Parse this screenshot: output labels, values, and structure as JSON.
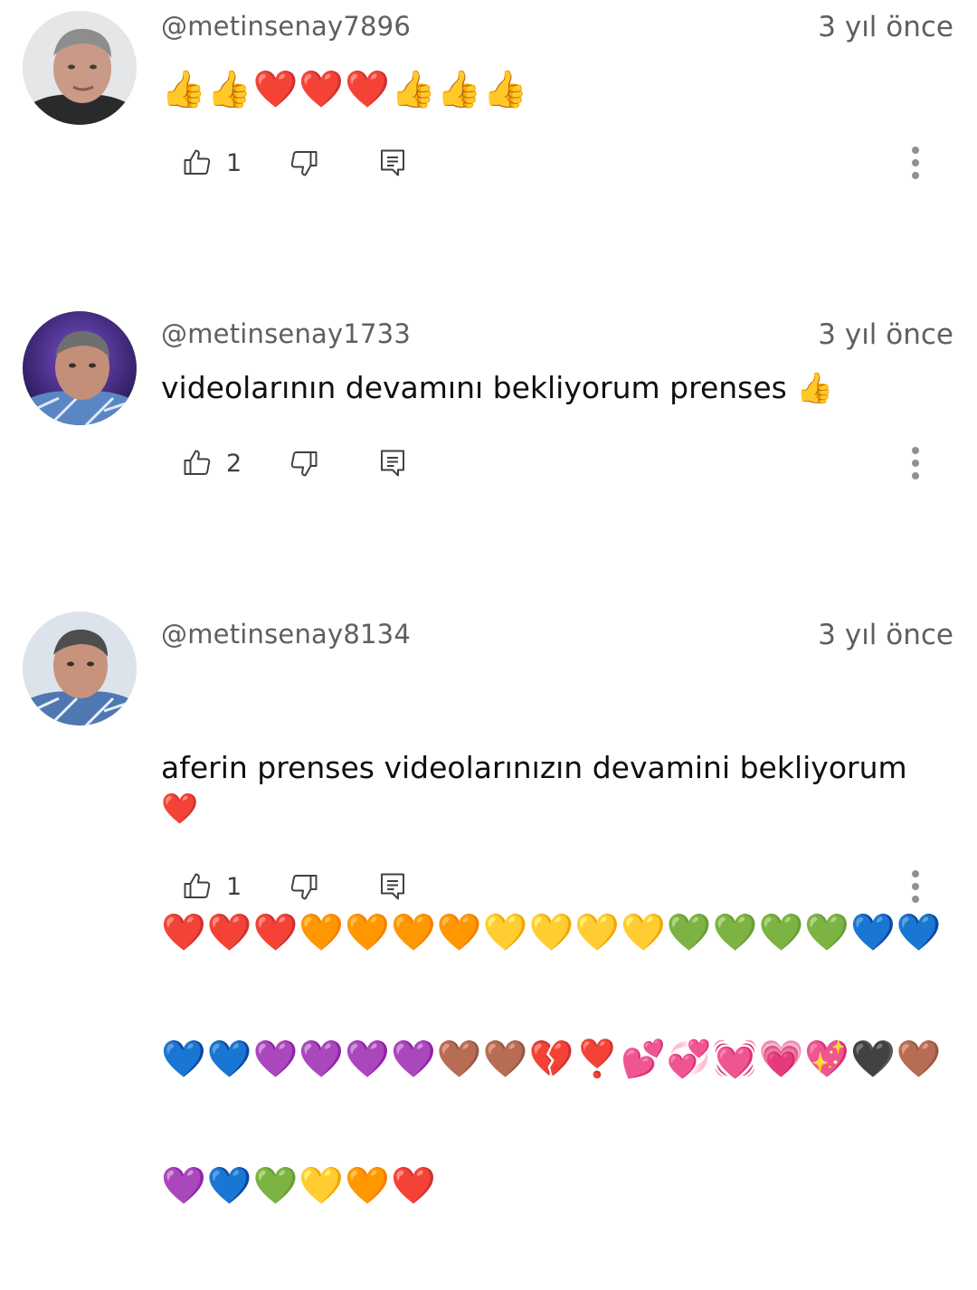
{
  "comments": [
    {
      "author": "@metinsenay7896",
      "time": "3 yıl önce",
      "text": "👍👍❤️❤️❤️👍👍👍",
      "likes": "1"
    },
    {
      "author": "@metinsenay1733",
      "time": "3 yıl önce",
      "text": "videolarının devamını bekliyorum prenses 👍",
      "likes": "2"
    },
    {
      "author": "@metinsenay8134",
      "time": "3 yıl önce",
      "text": "aferin prenses videolarınızın devamini bekliyorum  ❤️",
      "text_line2": "❤️❤️❤️🧡🧡🧡🧡💛💛💛💛💚💚💚💚💙💙",
      "text_line3": "💙💙💜💜💜💜🤎🤎💔❣️💕💞💓💗💖🖤🤎",
      "text_line4": "💜💙💚💛🧡❤️",
      "likes": "1"
    }
  ],
  "icons": {
    "like": "thumb-up-icon",
    "dislike": "thumb-down-icon",
    "reply": "reply-comment-icon",
    "more": "more-vertical-icon"
  },
  "colors": {
    "text": "#0f0f0f",
    "secondary": "#5f5f5f",
    "icon": "#3f3f3f"
  }
}
